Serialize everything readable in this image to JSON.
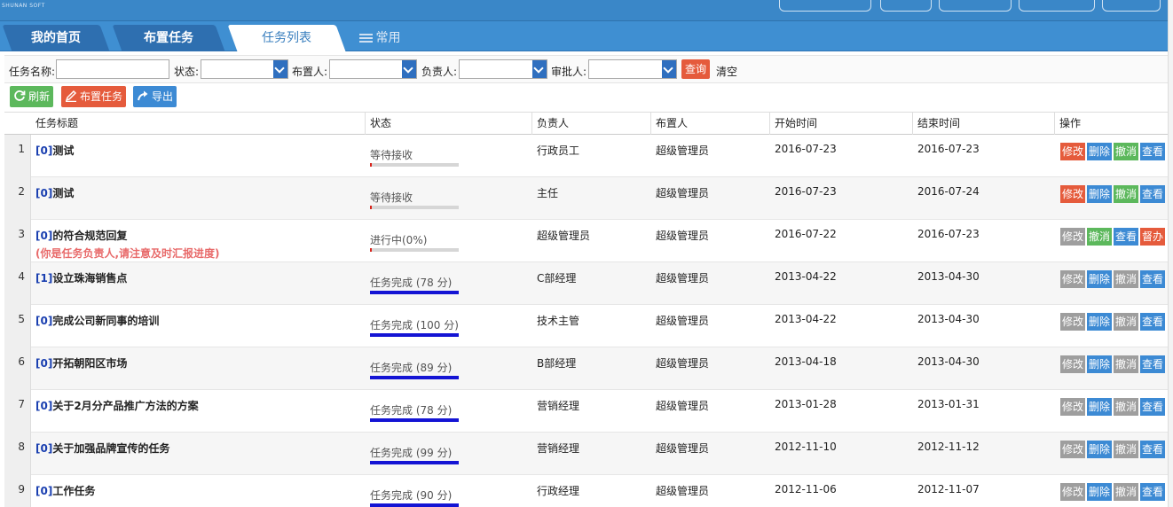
{
  "header": {
    "logo_text": "SHUNAN SOFT CO., LTD."
  },
  "tabs": [
    {
      "label": "我的首页",
      "state": "normal"
    },
    {
      "label": "布置任务",
      "state": "normal"
    },
    {
      "label": "任务列表",
      "state": "active"
    },
    {
      "label": "常用",
      "state": "menu"
    }
  ],
  "filter": {
    "task_name_label": "任务名称:",
    "task_name_value": "",
    "status_label": "状态:",
    "status_value": "",
    "assigner_label": "布置人:",
    "assigner_value": "",
    "owner_label": "负责人:",
    "owner_value": "",
    "approver_label": "审批人:",
    "approver_value": "",
    "query_button": "查询",
    "clear_link": "清空"
  },
  "toolbar": {
    "refresh_label": "刷新",
    "assign_label": "布置任务",
    "export_label": "导出"
  },
  "table": {
    "columns": [
      "任务标题",
      "状态",
      "负责人",
      "布置人",
      "开始时间",
      "结束时间",
      "操作"
    ],
    "rows": [
      {
        "num": "1",
        "id": "[0]",
        "title": "测试",
        "note": "",
        "status": "等待接收",
        "progress": 0.02,
        "progress_color": "#d9251d",
        "owner": "行政员工",
        "assigner": "超级管理员",
        "start": "2016-07-23",
        "end": "2016-07-23",
        "ops": [
          {
            "label": "修改",
            "color": "red"
          },
          {
            "label": "删除",
            "color": "blue"
          },
          {
            "label": "撤消",
            "color": "green"
          },
          {
            "label": "查看",
            "color": "blue"
          }
        ]
      },
      {
        "num": "2",
        "id": "[0]",
        "title": "测试",
        "note": "",
        "status": "等待接收",
        "progress": 0.02,
        "progress_color": "#d9251d",
        "owner": "主任",
        "assigner": "超级管理员",
        "start": "2016-07-23",
        "end": "2016-07-24",
        "ops": [
          {
            "label": "修改",
            "color": "red"
          },
          {
            "label": "删除",
            "color": "blue"
          },
          {
            "label": "撤消",
            "color": "green"
          },
          {
            "label": "查看",
            "color": "blue"
          }
        ]
      },
      {
        "num": "3",
        "id": "[0]",
        "title": "的符合规范回复",
        "note": "(你是任务负责人,请注意及时汇报进度)",
        "status": "进行中(0%)",
        "progress": 0,
        "progress_color": "#d9251d",
        "owner": "超级管理员",
        "assigner": "超级管理员",
        "start": "2016-07-22",
        "end": "2016-07-23",
        "ops": [
          {
            "label": "修改",
            "color": "gray"
          },
          {
            "label": "撤消",
            "color": "green"
          },
          {
            "label": "查看",
            "color": "blue"
          },
          {
            "label": "督办",
            "color": "red"
          }
        ]
      },
      {
        "num": "4",
        "id": "[1]",
        "title": "设立珠海销售点",
        "note": "",
        "status": "任务完成 (78 分)",
        "progress": 1,
        "progress_color": "#1414d4",
        "owner": "C部经理",
        "assigner": "超级管理员",
        "start": "2013-04-22",
        "end": "2013-04-30",
        "ops": [
          {
            "label": "修改",
            "color": "gray"
          },
          {
            "label": "删除",
            "color": "blue"
          },
          {
            "label": "撤消",
            "color": "gray"
          },
          {
            "label": "查看",
            "color": "blue"
          }
        ]
      },
      {
        "num": "5",
        "id": "[0]",
        "title": "完成公司新同事的培训",
        "note": "",
        "status": "任务完成 (100 分)",
        "progress": 1,
        "progress_color": "#1414d4",
        "owner": "技术主管",
        "assigner": "超级管理员",
        "start": "2013-04-22",
        "end": "2013-04-30",
        "ops": [
          {
            "label": "修改",
            "color": "gray"
          },
          {
            "label": "删除",
            "color": "blue"
          },
          {
            "label": "撤消",
            "color": "gray"
          },
          {
            "label": "查看",
            "color": "blue"
          }
        ]
      },
      {
        "num": "6",
        "id": "[0]",
        "title": "开拓朝阳区市场",
        "note": "",
        "status": "任务完成 (89 分)",
        "progress": 1,
        "progress_color": "#1414d4",
        "owner": "B部经理",
        "assigner": "超级管理员",
        "start": "2013-04-18",
        "end": "2013-04-30",
        "ops": [
          {
            "label": "修改",
            "color": "gray"
          },
          {
            "label": "删除",
            "color": "blue"
          },
          {
            "label": "撤消",
            "color": "gray"
          },
          {
            "label": "查看",
            "color": "blue"
          }
        ]
      },
      {
        "num": "7",
        "id": "[0]",
        "title": "关于2月分产品推广方法的方案",
        "note": "",
        "status": "任务完成 (78 分)",
        "progress": 1,
        "progress_color": "#1414d4",
        "owner": "营销经理",
        "assigner": "超级管理员",
        "start": "2013-01-28",
        "end": "2013-01-31",
        "ops": [
          {
            "label": "修改",
            "color": "gray"
          },
          {
            "label": "删除",
            "color": "blue"
          },
          {
            "label": "撤消",
            "color": "gray"
          },
          {
            "label": "查看",
            "color": "blue"
          }
        ]
      },
      {
        "num": "8",
        "id": "[0]",
        "title": "关于加强品牌宣传的任务",
        "note": "",
        "status": "任务完成 (99 分)",
        "progress": 1,
        "progress_color": "#1414d4",
        "owner": "营销经理",
        "assigner": "超级管理员",
        "start": "2012-11-10",
        "end": "2012-11-12",
        "ops": [
          {
            "label": "修改",
            "color": "gray"
          },
          {
            "label": "删除",
            "color": "blue"
          },
          {
            "label": "撤消",
            "color": "gray"
          },
          {
            "label": "查看",
            "color": "blue"
          }
        ]
      },
      {
        "num": "9",
        "id": "[0]",
        "title": "工作任务",
        "note": "",
        "status": "任务完成 (90 分)",
        "progress": 1,
        "progress_color": "#1414d4",
        "owner": "行政经理",
        "assigner": "超级管理员",
        "start": "2012-11-06",
        "end": "2012-11-07",
        "ops": [
          {
            "label": "修改",
            "color": "gray"
          },
          {
            "label": "删除",
            "color": "blue"
          },
          {
            "label": "撤消",
            "color": "gray"
          },
          {
            "label": "查看",
            "color": "blue"
          }
        ]
      }
    ]
  }
}
